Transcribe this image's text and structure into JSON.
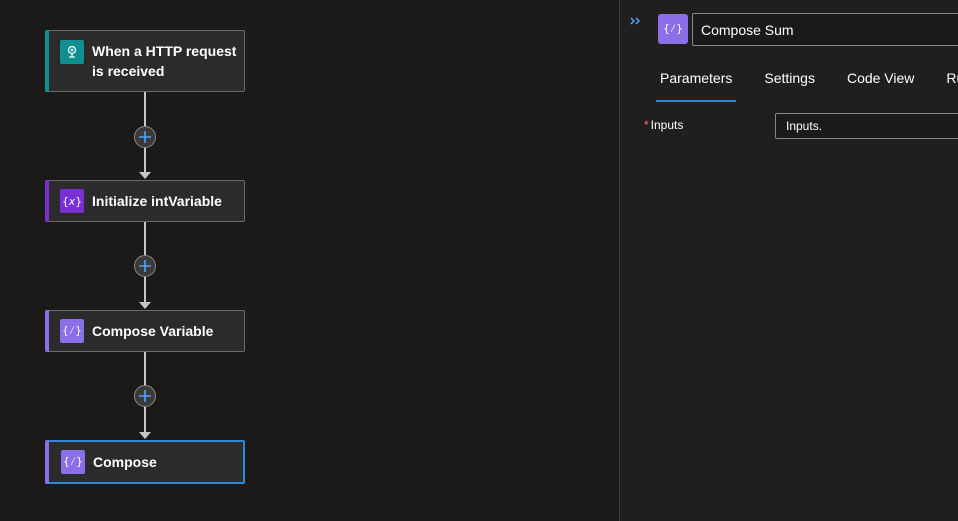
{
  "canvas": {
    "nodes": [
      {
        "label_line1": "When a HTTP request",
        "label_line2": "is received",
        "icon": "http-request-icon",
        "accent": "#0f8f8f"
      },
      {
        "label": "Initialize intVariable",
        "icon": "variable-icon",
        "accent": "#7a2fd2"
      },
      {
        "label": "Compose Variable",
        "icon": "compose-icon",
        "accent": "#8a6fe8"
      },
      {
        "label": "Compose",
        "icon": "compose-icon",
        "accent": "#8a6fe8"
      }
    ],
    "add_button_icon": "plus-icon"
  },
  "panel": {
    "collapse_icon": "double-chevron-right-icon",
    "title_value": "Compose Sum",
    "tabs": [
      "Parameters",
      "Settings",
      "Code View",
      "Run After"
    ],
    "active_tab": "Parameters",
    "fields": [
      {
        "required_mark": "*",
        "label": "Inputs",
        "value": "Inputs."
      }
    ]
  },
  "colors": {
    "selection": "#2f86d8",
    "compose": "#8a6fe8",
    "variable": "#7a2fd2",
    "http": "#0f8f8f"
  }
}
